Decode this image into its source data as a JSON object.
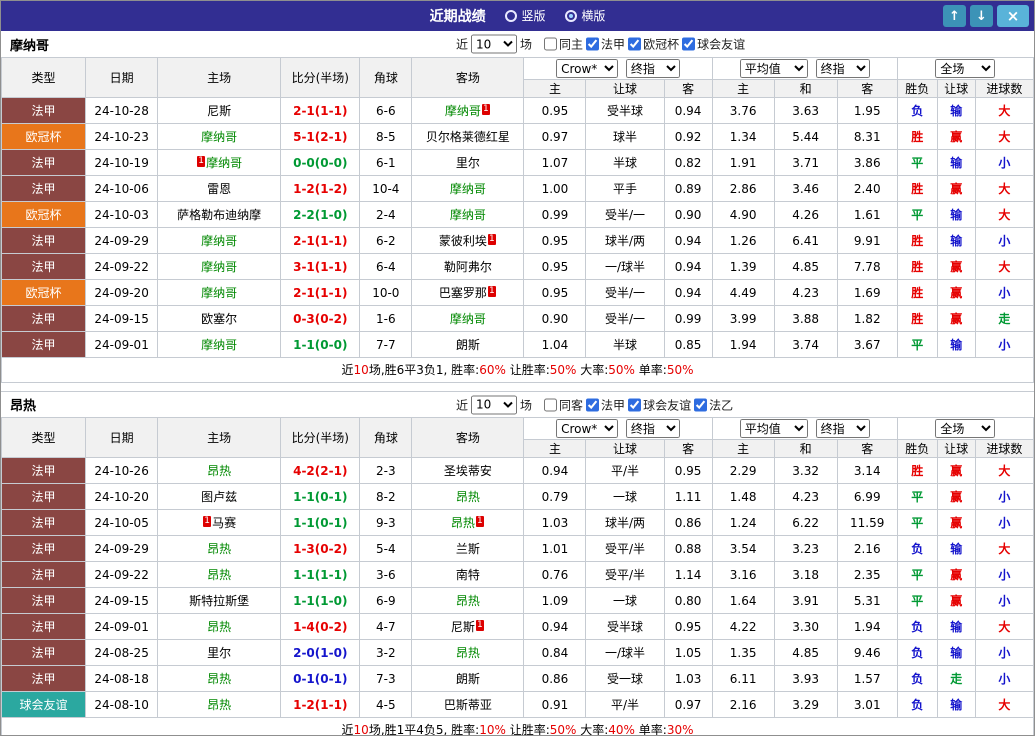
{
  "titlebar": {
    "title": "近期战绩",
    "radio_vertical": "竖版",
    "radio_horizontal": "横版",
    "selected_layout": "横版"
  },
  "colors": {
    "titlebar_bg": "#322e92",
    "win_red": "#e60000",
    "draw_green": "#009933",
    "loss_blue": "#1414cc",
    "ligue1_badge": "#8a4643",
    "ucl_badge": "#e8761b",
    "friendly_badge": "#2ba8a0",
    "focus_team_green": "#008800"
  },
  "columns": {
    "type": "类型",
    "date": "日期",
    "home": "主场",
    "score": "比分(半场)",
    "corner": "角球",
    "away": "客场",
    "odds_sel1": "Crow*",
    "odds_sel2": "终指",
    "euro_sel1": "平均值",
    "euro_sel2": "终指",
    "result_sel": "全场",
    "sub_home": "主",
    "sub_handicap": "让球",
    "sub_away": "客",
    "sub_home2": "主",
    "sub_draw": "和",
    "sub_away2": "客",
    "sub_result": "胜负",
    "sub_handicap2": "让球",
    "sub_goals": "进球数"
  },
  "monaco": {
    "team": "摩纳哥",
    "filters": {
      "near": "近",
      "count": "10",
      "games": "场",
      "cbs": [
        {
          "label": "同主",
          "checked": false
        },
        {
          "label": "法甲",
          "checked": true
        },
        {
          "label": "欧冠杯",
          "checked": true
        },
        {
          "label": "球会友谊",
          "checked": true
        }
      ]
    },
    "rows": [
      {
        "type": "法甲",
        "date": "24-10-28",
        "home": {
          "name": "尼斯"
        },
        "score": "2-1(1-1)",
        "score_color": "red",
        "corner": "6-6",
        "away": {
          "name": "摩纳哥",
          "focus": true,
          "card": "1",
          "card_pos": "after"
        },
        "o1": "0.95",
        "handicap": "受半球",
        "o2": "0.94",
        "e1": "3.76",
        "e2": "3.63",
        "e3": "1.95",
        "r1": "负",
        "r2": "输",
        "r3": "大"
      },
      {
        "type": "欧冠杯",
        "date": "24-10-23",
        "home": {
          "name": "摩纳哥",
          "focus": true
        },
        "score": "5-1(2-1)",
        "score_color": "red",
        "corner": "8-5",
        "away": {
          "name": "贝尔格莱德红星"
        },
        "o1": "0.97",
        "handicap": "球半",
        "o2": "0.92",
        "e1": "1.34",
        "e2": "5.44",
        "e3": "8.31",
        "r1": "胜",
        "r2": "赢",
        "r3": "大"
      },
      {
        "type": "法甲",
        "date": "24-10-19",
        "home": {
          "name": "摩纳哥",
          "focus": true,
          "card": "1",
          "card_pos": "before"
        },
        "score": "0-0(0-0)",
        "score_color": "green",
        "corner": "6-1",
        "away": {
          "name": "里尔"
        },
        "o1": "1.07",
        "handicap": "半球",
        "o2": "0.82",
        "e1": "1.91",
        "e2": "3.71",
        "e3": "3.86",
        "r1": "平",
        "r2": "输",
        "r3": "小"
      },
      {
        "type": "法甲",
        "date": "24-10-06",
        "home": {
          "name": "雷恩"
        },
        "score": "1-2(1-2)",
        "score_color": "red",
        "corner": "10-4",
        "away": {
          "name": "摩纳哥",
          "focus": true
        },
        "o1": "1.00",
        "handicap": "平手",
        "o2": "0.89",
        "e1": "2.86",
        "e2": "3.46",
        "e3": "2.40",
        "r1": "胜",
        "r2": "赢",
        "r3": "大"
      },
      {
        "type": "欧冠杯",
        "date": "24-10-03",
        "home": {
          "name": "萨格勒布迪纳摩"
        },
        "score": "2-2(1-0)",
        "score_color": "green",
        "corner": "2-4",
        "away": {
          "name": "摩纳哥",
          "focus": true
        },
        "o1": "0.99",
        "handicap": "受半/一",
        "o2": "0.90",
        "e1": "4.90",
        "e2": "4.26",
        "e3": "1.61",
        "r1": "平",
        "r2": "输",
        "r3": "大"
      },
      {
        "type": "法甲",
        "date": "24-09-29",
        "home": {
          "name": "摩纳哥",
          "focus": true
        },
        "score": "2-1(1-1)",
        "score_color": "red",
        "corner": "6-2",
        "away": {
          "name": "蒙彼利埃",
          "card": "1",
          "card_pos": "after"
        },
        "o1": "0.95",
        "handicap": "球半/两",
        "o2": "0.94",
        "e1": "1.26",
        "e2": "6.41",
        "e3": "9.91",
        "r1": "胜",
        "r2": "输",
        "r3": "小"
      },
      {
        "type": "法甲",
        "date": "24-09-22",
        "home": {
          "name": "摩纳哥",
          "focus": true
        },
        "score": "3-1(1-1)",
        "score_color": "red",
        "corner": "6-4",
        "away": {
          "name": "勒阿弗尔"
        },
        "o1": "0.95",
        "handicap": "一/球半",
        "o2": "0.94",
        "e1": "1.39",
        "e2": "4.85",
        "e3": "7.78",
        "r1": "胜",
        "r2": "赢",
        "r3": "大"
      },
      {
        "type": "欧冠杯",
        "date": "24-09-20",
        "home": {
          "name": "摩纳哥",
          "focus": true
        },
        "score": "2-1(1-1)",
        "score_color": "red",
        "corner": "10-0",
        "away": {
          "name": "巴塞罗那",
          "card": "1",
          "card_pos": "after"
        },
        "o1": "0.95",
        "handicap": "受半/一",
        "o2": "0.94",
        "e1": "4.49",
        "e2": "4.23",
        "e3": "1.69",
        "r1": "胜",
        "r2": "赢",
        "r3": "小"
      },
      {
        "type": "法甲",
        "date": "24-09-15",
        "home": {
          "name": "欧塞尔"
        },
        "score": "0-3(0-2)",
        "score_color": "red",
        "corner": "1-6",
        "away": {
          "name": "摩纳哥",
          "focus": true
        },
        "o1": "0.90",
        "handicap": "受半/一",
        "o2": "0.99",
        "e1": "3.99",
        "e2": "3.88",
        "e3": "1.82",
        "r1": "胜",
        "r2": "赢",
        "r3": "走"
      },
      {
        "type": "法甲",
        "date": "24-09-01",
        "home": {
          "name": "摩纳哥",
          "focus": true
        },
        "score": "1-1(0-0)",
        "score_color": "green",
        "corner": "7-7",
        "away": {
          "name": "朗斯"
        },
        "o1": "1.04",
        "handicap": "半球",
        "o2": "0.85",
        "e1": "1.94",
        "e2": "3.74",
        "e3": "3.67",
        "r1": "平",
        "r2": "输",
        "r3": "小"
      }
    ],
    "summary": {
      "pre": "近",
      "count": "10",
      "mid": "场,胜6平3负1, 胜率:",
      "win_rate": "60%",
      "l2": " 让胜率:",
      "handicap_rate": "50%",
      "l3": " 大率:",
      "big_rate": "50%",
      "l4": " 单率:",
      "odd_rate": "50%"
    }
  },
  "angers": {
    "team": "昂热",
    "filters": {
      "near": "近",
      "count": "10",
      "games": "场",
      "cbs": [
        {
          "label": "同客",
          "checked": false
        },
        {
          "label": "法甲",
          "checked": true
        },
        {
          "label": "球会友谊",
          "checked": true
        },
        {
          "label": "法乙",
          "checked": true
        }
      ]
    },
    "rows": [
      {
        "type": "法甲",
        "date": "24-10-26",
        "home": {
          "name": "昂热",
          "focus": true
        },
        "score": "4-2(2-1)",
        "score_color": "red",
        "corner": "2-3",
        "away": {
          "name": "圣埃蒂安"
        },
        "o1": "0.94",
        "handicap": "平/半",
        "o2": "0.95",
        "e1": "2.29",
        "e2": "3.32",
        "e3": "3.14",
        "r1": "胜",
        "r2": "赢",
        "r3": "大"
      },
      {
        "type": "法甲",
        "date": "24-10-20",
        "home": {
          "name": "图卢兹"
        },
        "score": "1-1(0-1)",
        "score_color": "green",
        "corner": "8-2",
        "away": {
          "name": "昂热",
          "focus": true
        },
        "o1": "0.79",
        "handicap": "一球",
        "o2": "1.11",
        "e1": "1.48",
        "e2": "4.23",
        "e3": "6.99",
        "r1": "平",
        "r2": "赢",
        "r3": "小"
      },
      {
        "type": "法甲",
        "date": "24-10-05",
        "home": {
          "name": "马赛",
          "card": "1",
          "card_pos": "before"
        },
        "score": "1-1(0-1)",
        "score_color": "green",
        "corner": "9-3",
        "away": {
          "name": "昂热",
          "focus": true,
          "card": "1",
          "card_pos": "after"
        },
        "o1": "1.03",
        "handicap": "球半/两",
        "o2": "0.86",
        "e1": "1.24",
        "e2": "6.22",
        "e3": "11.59",
        "r1": "平",
        "r2": "赢",
        "r3": "小"
      },
      {
        "type": "法甲",
        "date": "24-09-29",
        "home": {
          "name": "昂热",
          "focus": true
        },
        "score": "1-3(0-2)",
        "score_color": "red",
        "corner": "5-4",
        "away": {
          "name": "兰斯"
        },
        "o1": "1.01",
        "handicap": "受平/半",
        "o2": "0.88",
        "e1": "3.54",
        "e2": "3.23",
        "e3": "2.16",
        "r1": "负",
        "r2": "输",
        "r3": "大"
      },
      {
        "type": "法甲",
        "date": "24-09-22",
        "home": {
          "name": "昂热",
          "focus": true
        },
        "score": "1-1(1-1)",
        "score_color": "green",
        "corner": "3-6",
        "away": {
          "name": "南特"
        },
        "o1": "0.76",
        "handicap": "受平/半",
        "o2": "1.14",
        "e1": "3.16",
        "e2": "3.18",
        "e3": "2.35",
        "r1": "平",
        "r2": "赢",
        "r3": "小"
      },
      {
        "type": "法甲",
        "date": "24-09-15",
        "home": {
          "name": "斯特拉斯堡"
        },
        "score": "1-1(1-0)",
        "score_color": "green",
        "corner": "6-9",
        "away": {
          "name": "昂热",
          "focus": true
        },
        "o1": "1.09",
        "handicap": "一球",
        "o2": "0.80",
        "e1": "1.64",
        "e2": "3.91",
        "e3": "5.31",
        "r1": "平",
        "r2": "赢",
        "r3": "小"
      },
      {
        "type": "法甲",
        "date": "24-09-01",
        "home": {
          "name": "昂热",
          "focus": true
        },
        "score": "1-4(0-2)",
        "score_color": "red",
        "corner": "4-7",
        "away": {
          "name": "尼斯",
          "card": "1",
          "card_pos": "after"
        },
        "o1": "0.94",
        "handicap": "受半球",
        "o2": "0.95",
        "e1": "4.22",
        "e2": "3.30",
        "e3": "1.94",
        "r1": "负",
        "r2": "输",
        "r3": "大"
      },
      {
        "type": "法甲",
        "date": "24-08-25",
        "home": {
          "name": "里尔"
        },
        "score": "2-0(1-0)",
        "score_color": "blue",
        "corner": "3-2",
        "away": {
          "name": "昂热",
          "focus": true
        },
        "o1": "0.84",
        "handicap": "一/球半",
        "o2": "1.05",
        "e1": "1.35",
        "e2": "4.85",
        "e3": "9.46",
        "r1": "负",
        "r2": "输",
        "r3": "小"
      },
      {
        "type": "法甲",
        "date": "24-08-18",
        "home": {
          "name": "昂热",
          "focus": true
        },
        "score": "0-1(0-1)",
        "score_color": "blue",
        "corner": "7-3",
        "away": {
          "name": "朗斯"
        },
        "o1": "0.86",
        "handicap": "受一球",
        "o2": "1.03",
        "e1": "6.11",
        "e2": "3.93",
        "e3": "1.57",
        "r1": "负",
        "r2": "走",
        "r3": "小"
      },
      {
        "type": "球会友谊",
        "date": "24-08-10",
        "home": {
          "name": "昂热",
          "focus": true
        },
        "score": "1-2(1-1)",
        "score_color": "red",
        "corner": "4-5",
        "away": {
          "name": "巴斯蒂亚"
        },
        "o1": "0.91",
        "handicap": "平/半",
        "o2": "0.97",
        "e1": "2.16",
        "e2": "3.29",
        "e3": "3.01",
        "r1": "负",
        "r2": "输",
        "r3": "大"
      }
    ],
    "summary": {
      "pre": "近",
      "count": "10",
      "mid": "场,胜1平4负5, 胜率:",
      "win_rate": "10%",
      "l2": " 让胜率:",
      "handicap_rate": "50%",
      "l3": " 大率:",
      "big_rate": "40%",
      "l4": " 单率:",
      "odd_rate": "30%"
    }
  }
}
